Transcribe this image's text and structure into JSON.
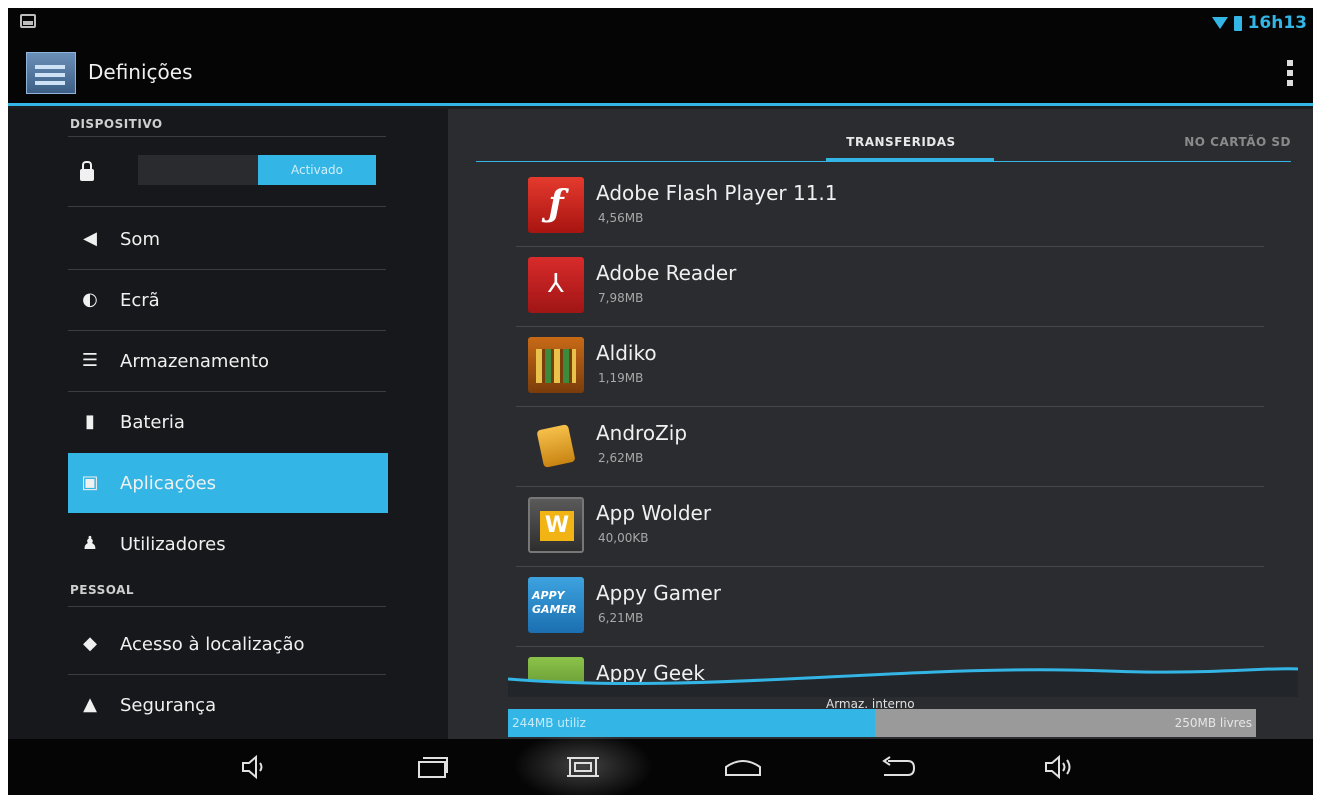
{
  "status_bar": {
    "time": "16h13"
  },
  "action_bar": {
    "title": "Definições"
  },
  "sidebar": {
    "sections": [
      {
        "header": "DISPOSITIVO"
      },
      {
        "header": "PESSOAL"
      }
    ],
    "toggle_label": "Activado",
    "items": [
      {
        "label": "Som",
        "icon": "speaker-icon"
      },
      {
        "label": "Ecrã",
        "icon": "brightness-icon"
      },
      {
        "label": "Armazenamento",
        "icon": "storage-icon"
      },
      {
        "label": "Bateria",
        "icon": "battery-icon"
      },
      {
        "label": "Aplicações",
        "icon": "apps-icon",
        "selected": true
      },
      {
        "label": "Utilizadores",
        "icon": "users-icon"
      },
      {
        "label": "Acesso à localização",
        "icon": "location-icon"
      },
      {
        "label": "Segurança",
        "icon": "lock-icon"
      }
    ]
  },
  "tabs": {
    "active": "TRANSFERIDAS",
    "other": "NO CARTÃO SD"
  },
  "apps": [
    {
      "name": "Adobe Flash Player 11.1",
      "size": "4,56MB",
      "icon": "flash-icon"
    },
    {
      "name": "Adobe Reader",
      "size": "7,98MB",
      "icon": "reader-icon"
    },
    {
      "name": "Aldiko",
      "size": "1,19MB",
      "icon": "aldiko-icon"
    },
    {
      "name": "AndroZip",
      "size": "2,62MB",
      "icon": "androzip-icon"
    },
    {
      "name": "App Wolder",
      "size": "40,00KB",
      "icon": "wolder-icon"
    },
    {
      "name": "Appy Gamer",
      "size": "6,21MB",
      "icon": "appy-gamer-icon"
    },
    {
      "name": "Appy Geek",
      "size": "",
      "icon": "appy-geek-icon"
    }
  ],
  "storage": {
    "label": "Armaz. interno",
    "used": "244MB utiliz",
    "free": "250MB livres",
    "used_fraction": 0.49
  },
  "colors": {
    "accent": "#33b5e5",
    "background": "#1c1d20"
  }
}
